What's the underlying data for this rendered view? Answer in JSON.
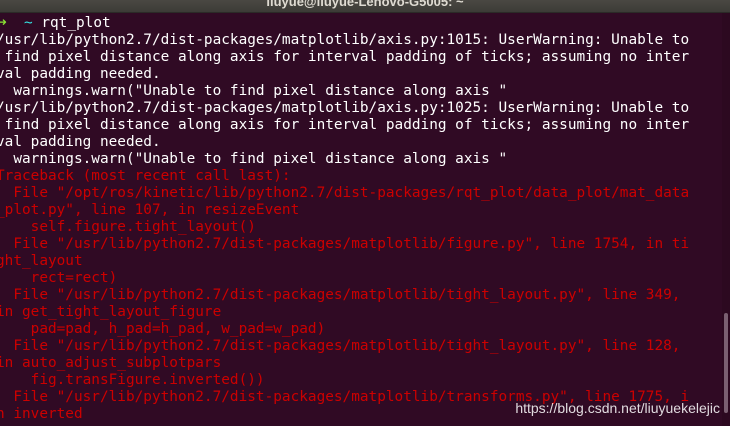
{
  "window": {
    "title": "liuyue@liuyue-Lenovo-G5005: ~"
  },
  "prompt": {
    "arrow": "➜",
    "dir": "~",
    "command": " rqt_plot"
  },
  "lines": [
    {
      "text": "/usr/lib/python2.7/dist-packages/matplotlib/axis.py:1015: UserWarning: Unable to",
      "style": "normal"
    },
    {
      "text": " find pixel distance along axis for interval padding of ticks; assuming no inter",
      "style": "normal"
    },
    {
      "text": "val padding needed.",
      "style": "normal"
    },
    {
      "text": "  warnings.warn(\"Unable to find pixel distance along axis \"",
      "style": "normal"
    },
    {
      "text": "/usr/lib/python2.7/dist-packages/matplotlib/axis.py:1025: UserWarning: Unable to",
      "style": "normal"
    },
    {
      "text": " find pixel distance along axis for interval padding of ticks; assuming no inter",
      "style": "normal"
    },
    {
      "text": "val padding needed.",
      "style": "normal"
    },
    {
      "text": "  warnings.warn(\"Unable to find pixel distance along axis \"",
      "style": "normal"
    },
    {
      "text": "Traceback (most recent call last):",
      "style": "error"
    },
    {
      "text": "  File \"/opt/ros/kinetic/lib/python2.7/dist-packages/rqt_plot/data_plot/mat_data",
      "style": "error"
    },
    {
      "text": "_plot.py\", line 107, in resizeEvent",
      "style": "error"
    },
    {
      "text": "    self.figure.tight_layout()",
      "style": "error"
    },
    {
      "text": "  File \"/usr/lib/python2.7/dist-packages/matplotlib/figure.py\", line 1754, in ti",
      "style": "error"
    },
    {
      "text": "ght_layout",
      "style": "error"
    },
    {
      "text": "    rect=rect)",
      "style": "error"
    },
    {
      "text": "  File \"/usr/lib/python2.7/dist-packages/matplotlib/tight_layout.py\", line 349,",
      "style": "error"
    },
    {
      "text": "in get_tight_layout_figure",
      "style": "error"
    },
    {
      "text": "    pad=pad, h_pad=h_pad, w_pad=w_pad)",
      "style": "error"
    },
    {
      "text": "  File \"/usr/lib/python2.7/dist-packages/matplotlib/tight_layout.py\", line 128,",
      "style": "error"
    },
    {
      "text": "in auto_adjust_subplotpars",
      "style": "error"
    },
    {
      "text": "    fig.transFigure.inverted())",
      "style": "error"
    },
    {
      "text": "  File \"/usr/lib/python2.7/dist-packages/matplotlib/transforms.py\", line 1775, i",
      "style": "error"
    },
    {
      "text": "n inverted",
      "style": "error"
    }
  ],
  "watermark": "https://blog.csdn.net/liuyuekelejic",
  "colors": {
    "background": "#300a24",
    "text": "#ffffff",
    "error": "#cc0000",
    "prompt_arrow": "#8ae234",
    "prompt_dir": "#34e2e2"
  }
}
